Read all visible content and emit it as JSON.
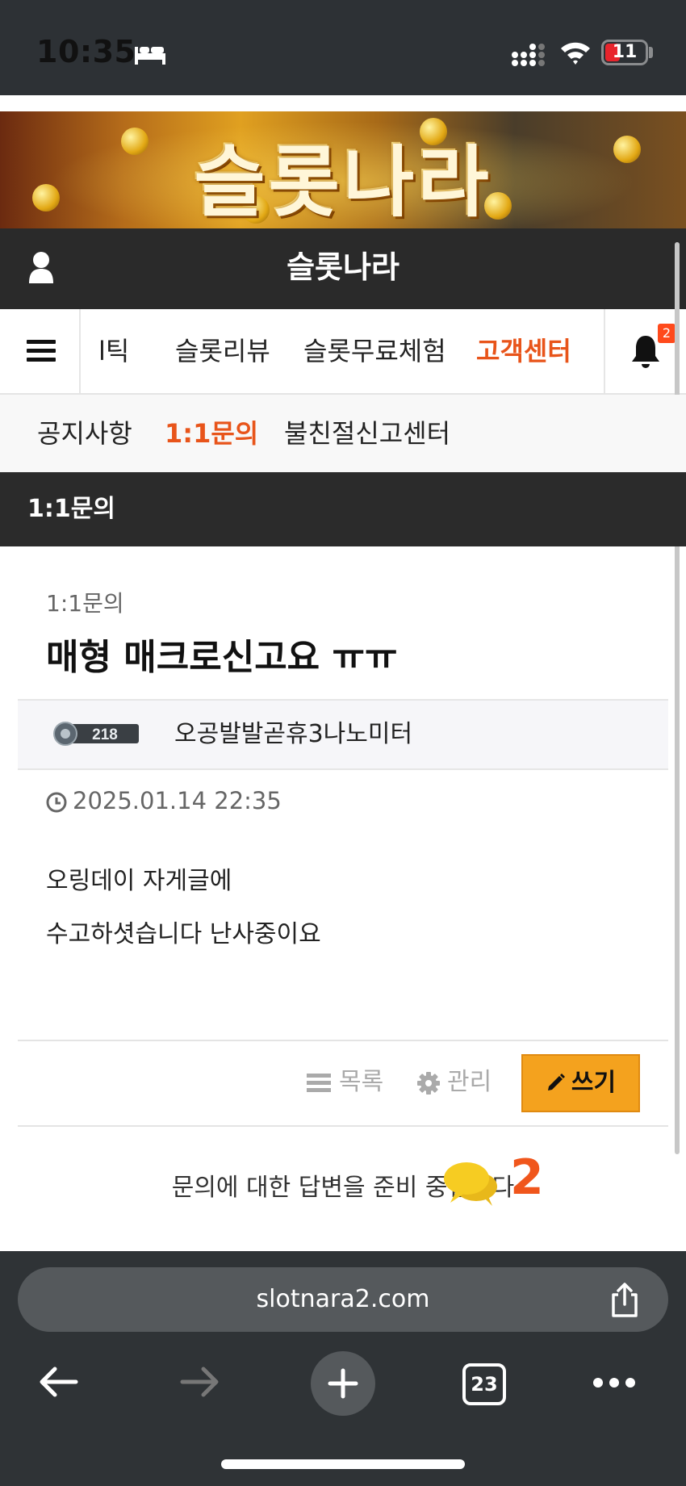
{
  "status_bar": {
    "time": "10:35",
    "battery": "11",
    "sleep_icon": "bed-icon",
    "signal_icon": "signal-icon",
    "wifi_icon": "wifi-icon"
  },
  "banner": {
    "title": "슬롯나라"
  },
  "header": {
    "title": "슬롯나라",
    "user_icon": "user-icon"
  },
  "main_nav": {
    "items": [
      {
        "label": "l틱"
      },
      {
        "label": "슬롯리뷰"
      },
      {
        "label": "슬롯무료체험"
      },
      {
        "label": "고객센터",
        "active": true
      }
    ],
    "notification_count": "2"
  },
  "sub_nav": {
    "items": [
      {
        "label": "공지사항"
      },
      {
        "label": "1:1문의",
        "active": true
      },
      {
        "label": "불친절신고센터"
      }
    ]
  },
  "section": {
    "title": "1:1문의"
  },
  "post": {
    "category": "1:1문의",
    "title": "매형 매크로신고요 ㅠㅠ",
    "author_level": "218",
    "author_name": "오공발발곧휴3나노미터",
    "date": "2025.01.14 22:35",
    "body": [
      "오링데이 자게글에",
      "수고하셧습니다 난사중이요"
    ]
  },
  "actions": {
    "list": "목록",
    "manage": "관리",
    "write": "쓰기"
  },
  "notice": {
    "text": "문의에 대한 답변을 준비 중입니다",
    "chat_count": "2"
  },
  "browser": {
    "url": "slotnara2.com",
    "tab_count": "23"
  },
  "colors": {
    "accent": "#e8541a",
    "write_button": "#f4a21e",
    "header_bg": "#2a2a2a",
    "browser_bg": "#2f3336"
  }
}
